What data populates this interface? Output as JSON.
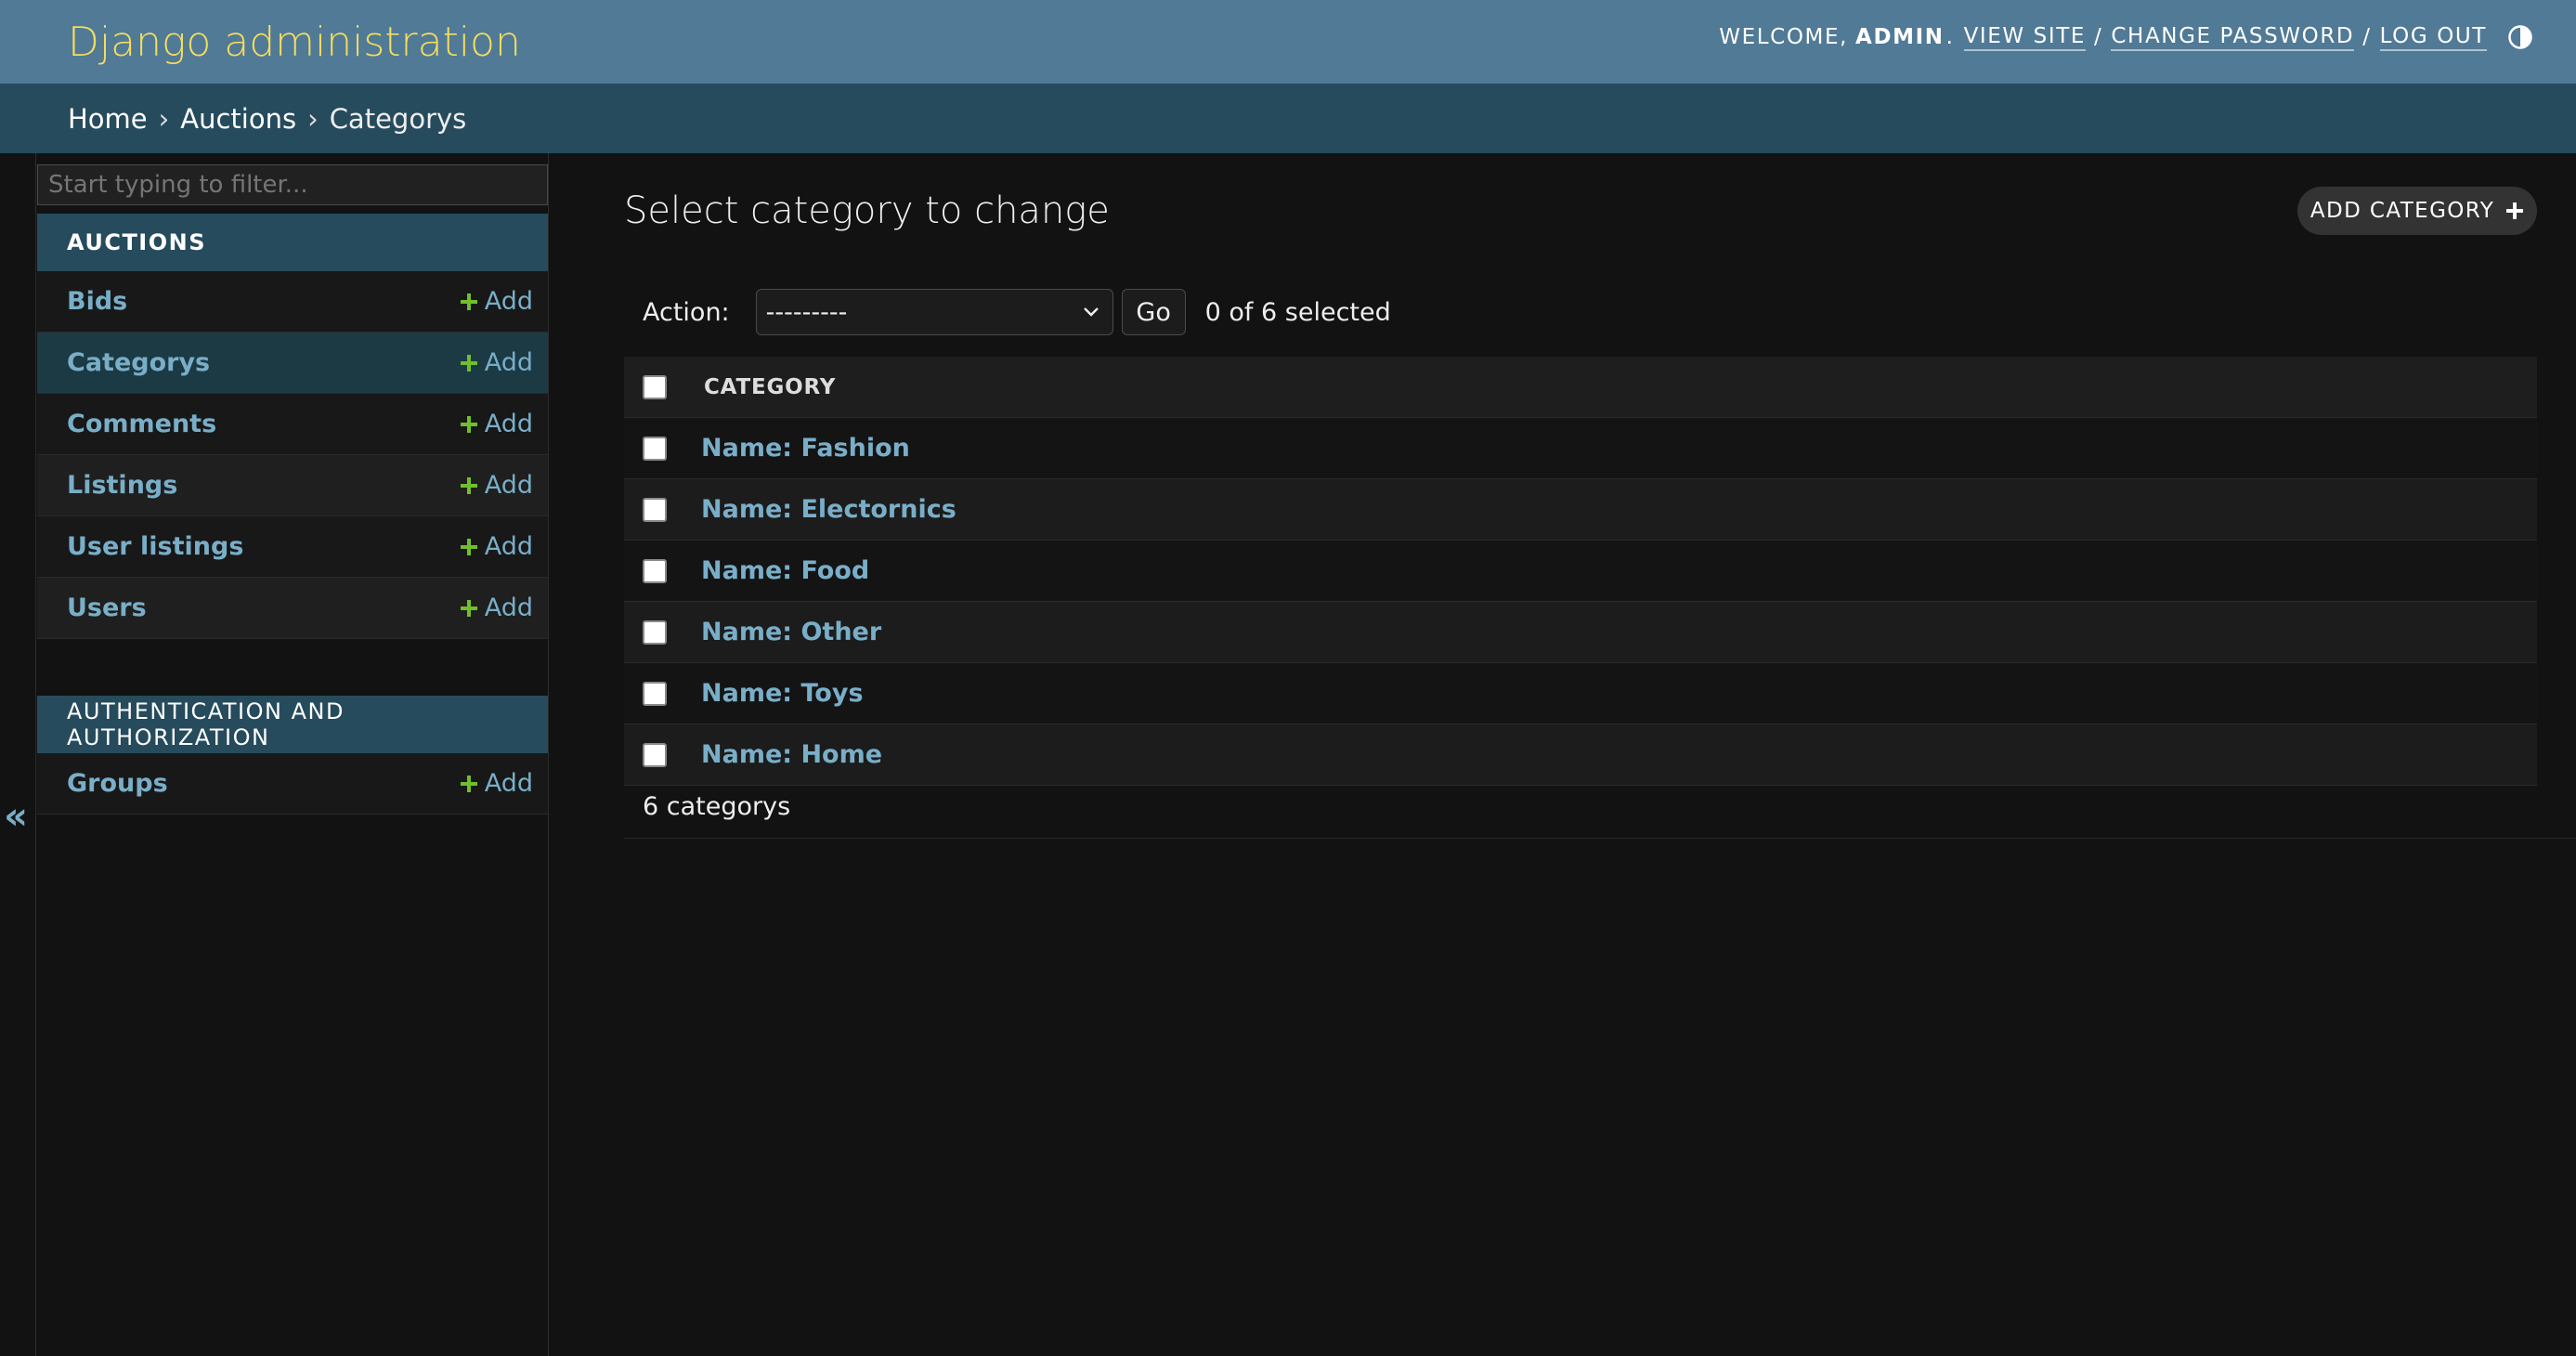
{
  "header": {
    "branding": "Django administration",
    "welcome": "Welcome,",
    "username": "admin",
    "username_suffix": ".",
    "view_site": "View site",
    "change_password": "Change password",
    "log_out": "Log out",
    "separator": "/",
    "theme_toggle_icon": "half-circle-icon"
  },
  "breadcrumbs": {
    "items": [
      "Home",
      "Auctions",
      "Categorys"
    ],
    "separator": "›"
  },
  "sidebar": {
    "filter_placeholder": "Start typing to filter...",
    "collapse_icon": "«",
    "modules": [
      {
        "caption": "Auctions",
        "models": [
          {
            "name": "Bids",
            "add": "Add"
          },
          {
            "name": "Categorys",
            "add": "Add"
          },
          {
            "name": "Comments",
            "add": "Add"
          },
          {
            "name": "Listings",
            "add": "Add"
          },
          {
            "name": "User listings",
            "add": "Add"
          },
          {
            "name": "Users",
            "add": "Add"
          }
        ]
      },
      {
        "caption": "Authentication and Authorization",
        "models": [
          {
            "name": "Groups",
            "add": "Add"
          }
        ]
      }
    ]
  },
  "main": {
    "title": "Select category to change",
    "add_button": "Add category",
    "actions": {
      "label": "Action:",
      "selected_value": "---------",
      "go": "Go",
      "counter": "0 of 6 selected"
    },
    "table": {
      "column_header": "Category",
      "rows": [
        "Name: Fashion",
        "Name: Electornics",
        "Name: Food",
        "Name: Other",
        "Name: Toys",
        "Name: Home"
      ]
    },
    "paginator": "6 categorys"
  },
  "colors": {
    "header_bg": "#517a96",
    "branding": "#f5dd5d",
    "breadcrumbs_bg": "#264b5d",
    "link": "#79aec8",
    "add_icon": "#70bf2b",
    "body_bg": "#121212"
  }
}
